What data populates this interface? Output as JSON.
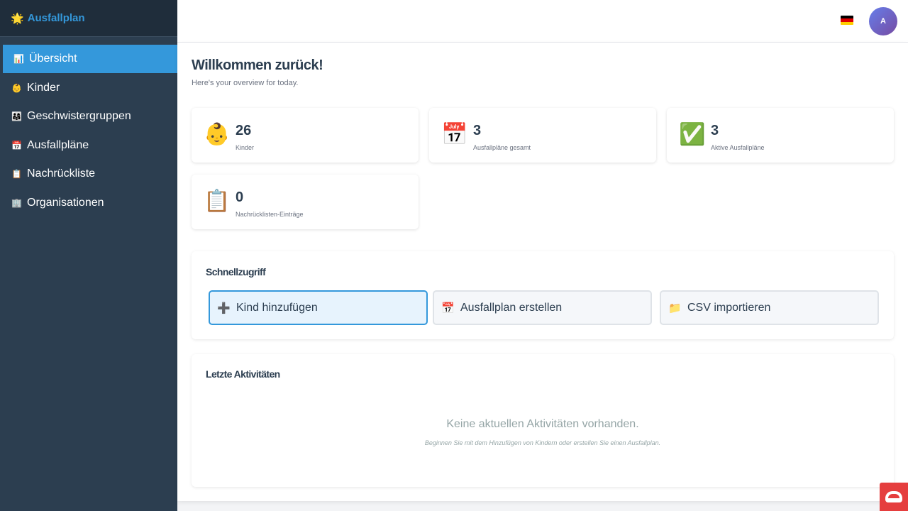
{
  "brand": {
    "icon": "🌟",
    "name": "Ausfallplan"
  },
  "sidebar": {
    "items": [
      {
        "icon": "📊",
        "label": "Übersicht",
        "active": true
      },
      {
        "icon": "👶",
        "label": "Kinder"
      },
      {
        "icon": "👨‍👩‍👧",
        "label": "Geschwistergruppen"
      },
      {
        "icon": "📅",
        "label": "Ausfallpläne"
      },
      {
        "icon": "📋",
        "label": "Nachrückliste"
      },
      {
        "icon": "🏢",
        "label": "Organisationen"
      }
    ]
  },
  "topbar": {
    "flag": {
      "name": "german-flag-icon",
      "colors": [
        "#000000",
        "#dd0000",
        "#ffce00"
      ]
    },
    "avatar_initial": "A"
  },
  "page": {
    "title": "Willkommen zurück!",
    "subtitle": "Here's your overview for today."
  },
  "stats": [
    {
      "icon": "👶",
      "value": "26",
      "label": "Kinder"
    },
    {
      "icon": "📅",
      "value": "3",
      "label": "Ausfallpläne gesamt"
    },
    {
      "icon": "✅",
      "value": "3",
      "label": "Aktive Ausfallpläne"
    },
    {
      "icon": "📋",
      "value": "0",
      "label": "Nachrücklisten-Einträge"
    }
  ],
  "quick_access": {
    "title": "Schnellzugriff",
    "buttons": [
      {
        "icon": "➕",
        "label": "Kind hinzufügen"
      },
      {
        "icon": "📅",
        "label": "Ausfallplan erstellen"
      },
      {
        "icon": "📁",
        "label": "CSV importieren"
      }
    ]
  },
  "activities": {
    "title": "Letzte Aktivitäten",
    "empty_text": "Keine aktuellen Aktivitäten vorhanden.",
    "empty_hint": "Beginnen Sie mit dem Hinzufügen von Kindern oder erstellen Sie einen Ausfallplan."
  },
  "colors": {
    "sidebar_bg": "#2c3e50",
    "accent": "#3498db",
    "badge": "#e53e3e"
  }
}
